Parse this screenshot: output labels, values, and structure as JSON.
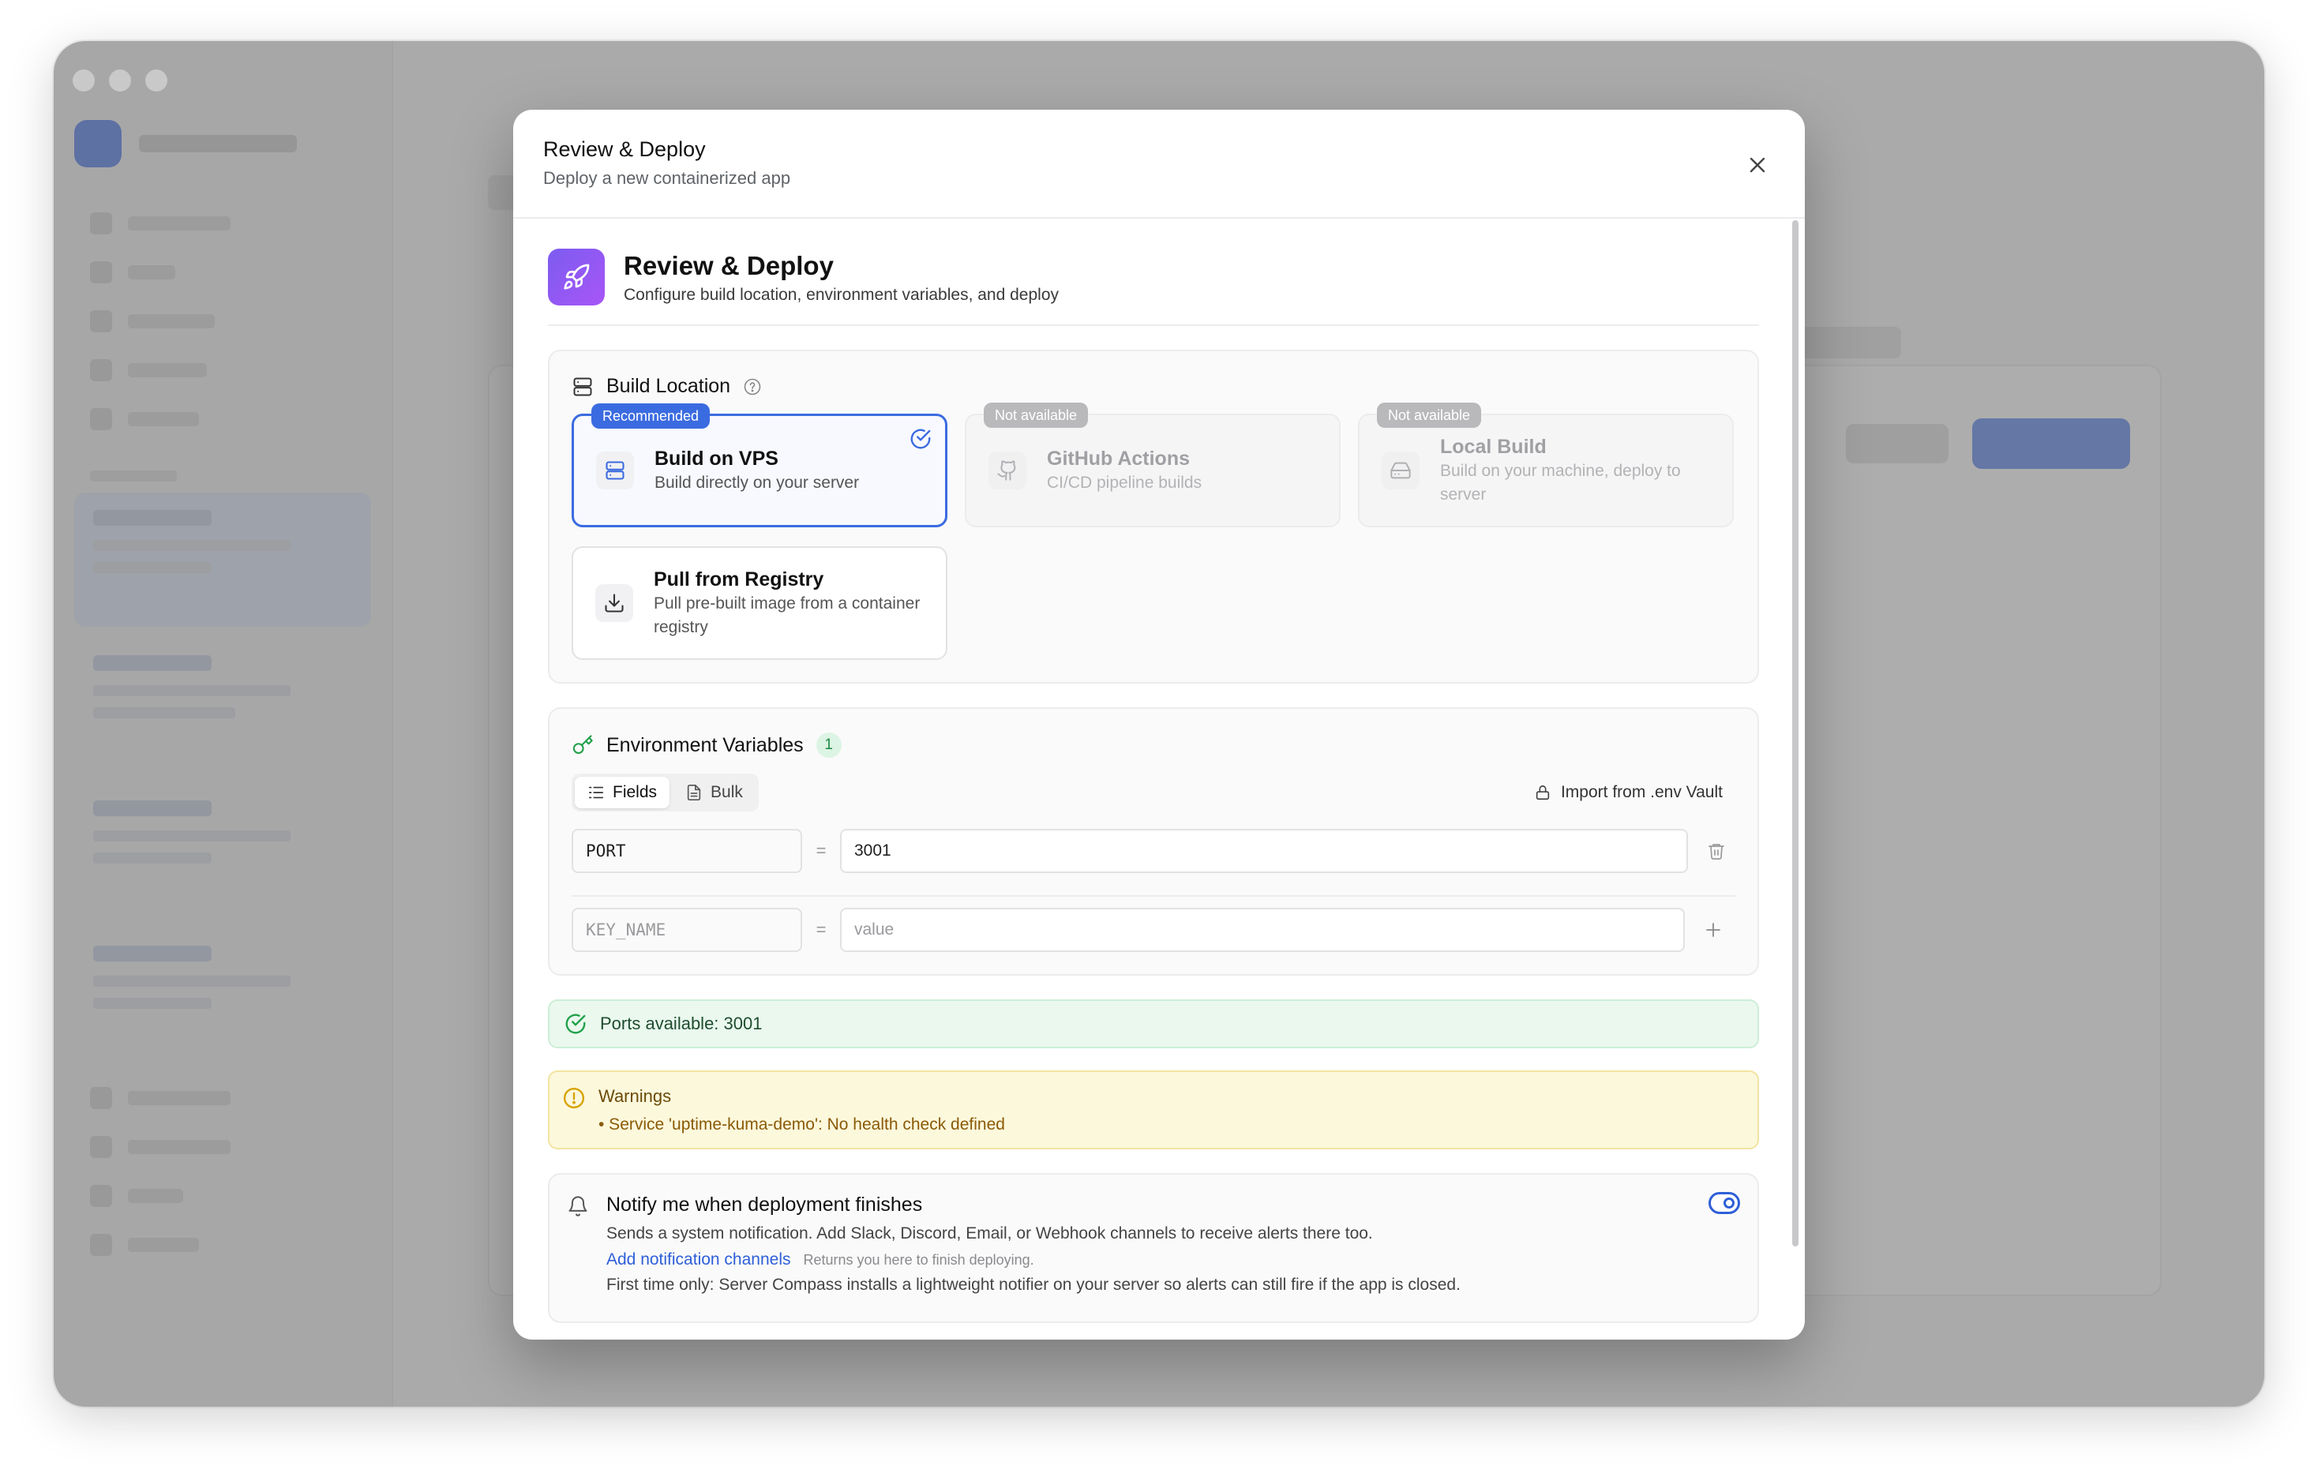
{
  "modal": {
    "title": "Review & Deploy",
    "subtitle": "Deploy a new containerized app"
  },
  "step": {
    "title": "Review & Deploy",
    "subtitle": "Configure build location, environment variables, and deploy"
  },
  "build_location": {
    "title": "Build Location",
    "options": [
      {
        "name": "Build on VPS",
        "desc": "Build directly on your server",
        "badge": "Recommended",
        "selected": true,
        "available": true,
        "icon": "server-icon"
      },
      {
        "name": "GitHub Actions",
        "desc": "CI/CD pipeline builds",
        "badge": "Not available",
        "selected": false,
        "available": false,
        "icon": "github-icon"
      },
      {
        "name": "Local Build",
        "desc": "Build on your machine, deploy to server",
        "badge": "Not available",
        "selected": false,
        "available": false,
        "icon": "hard-drive-icon"
      },
      {
        "name": "Pull from Registry",
        "desc": "Pull pre-built image from a container registry",
        "badge": "",
        "selected": false,
        "available": true,
        "icon": "download-icon"
      }
    ]
  },
  "env": {
    "title": "Environment Variables",
    "count": "1",
    "tabs": [
      "Fields",
      "Bulk"
    ],
    "import_label": "Import from .env Vault",
    "rows": [
      {
        "key": "PORT",
        "value": "3001"
      }
    ],
    "new_row": {
      "key_placeholder": "KEY_NAME",
      "value_placeholder": "value"
    },
    "eq": "="
  },
  "ports": {
    "text": "Ports available: 3001"
  },
  "warnings": {
    "title": "Warnings",
    "items": [
      "• Service 'uptime-kuma-demo': No health check defined"
    ]
  },
  "notify": {
    "title": "Notify me when deployment finishes",
    "desc": "Sends a system notification. Add Slack, Discord, Email, or Webhook channels to receive alerts there too.",
    "link": "Add notification channels",
    "hint": "Returns you here to finish deploying.",
    "first_time": "First time only: Server Compass installs a lightweight notifier on your server so alerts can still fire if the app is closed.",
    "enabled": true
  },
  "colors": {
    "accent": "#3b6be0",
    "success": "#1e8a44",
    "warning": "#d8a200",
    "rocket_gradient": "#7c5cf0"
  }
}
